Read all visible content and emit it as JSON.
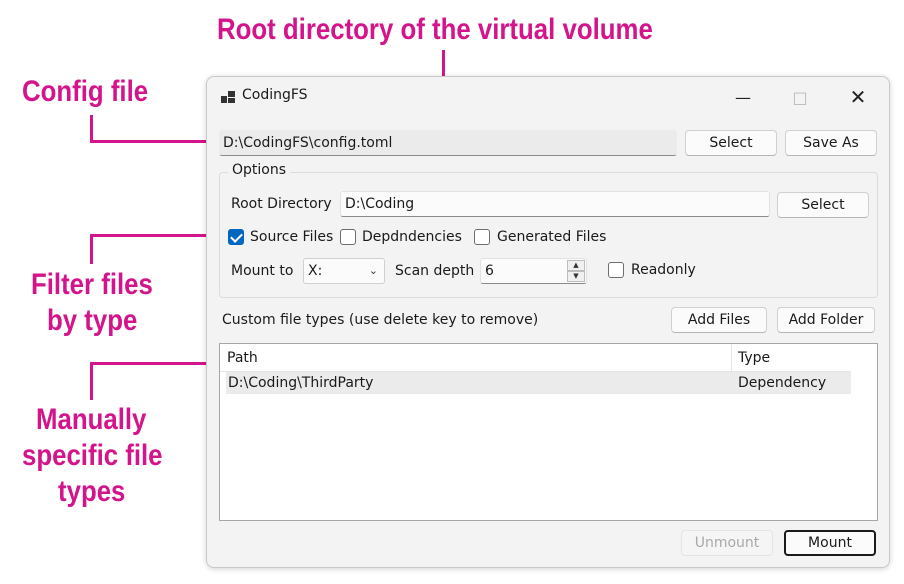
{
  "annotations": {
    "root_directory": "Root directory of the virtual volume",
    "config_file": "Config file",
    "filter_line1": "Filter files",
    "filter_line2": "by type",
    "manual_line1": "Manually",
    "manual_line2": "specific file",
    "manual_line3": "types",
    "color": "#d4148a"
  },
  "window": {
    "title": "CodingFS",
    "icons": {
      "app": "app-icon",
      "minimize": "minimize-icon",
      "maximize": "maximize-icon",
      "close": "close-icon"
    }
  },
  "config": {
    "path": "D:\\CodingFS\\config.toml",
    "select_label": "Select",
    "save_as_label": "Save As"
  },
  "options": {
    "legend": "Options",
    "root_directory_label": "Root Directory",
    "root_directory_value": "D:\\Coding",
    "root_select_label": "Select",
    "filters": [
      {
        "label": "Source Files",
        "checked": true
      },
      {
        "label": "Depdndencies",
        "checked": false
      },
      {
        "label": "Generated Files",
        "checked": false
      }
    ],
    "mount_to_label": "Mount to",
    "mount_to_value": "X:",
    "scan_depth_label": "Scan depth",
    "scan_depth_value": "6",
    "readonly_label": "Readonly",
    "readonly_checked": false
  },
  "custom_types": {
    "label": "Custom file types (use delete key to remove)",
    "add_files_label": "Add Files",
    "add_folder_label": "Add Folder",
    "columns": [
      "Path",
      "Type"
    ],
    "rows": [
      {
        "path": "D:\\Coding\\ThirdParty",
        "type": "Dependency"
      }
    ]
  },
  "footer": {
    "unmount_label": "Unmount",
    "mount_label": "Mount"
  },
  "colors": {
    "accent": "#0067c0",
    "annotation": "#d4148a"
  }
}
